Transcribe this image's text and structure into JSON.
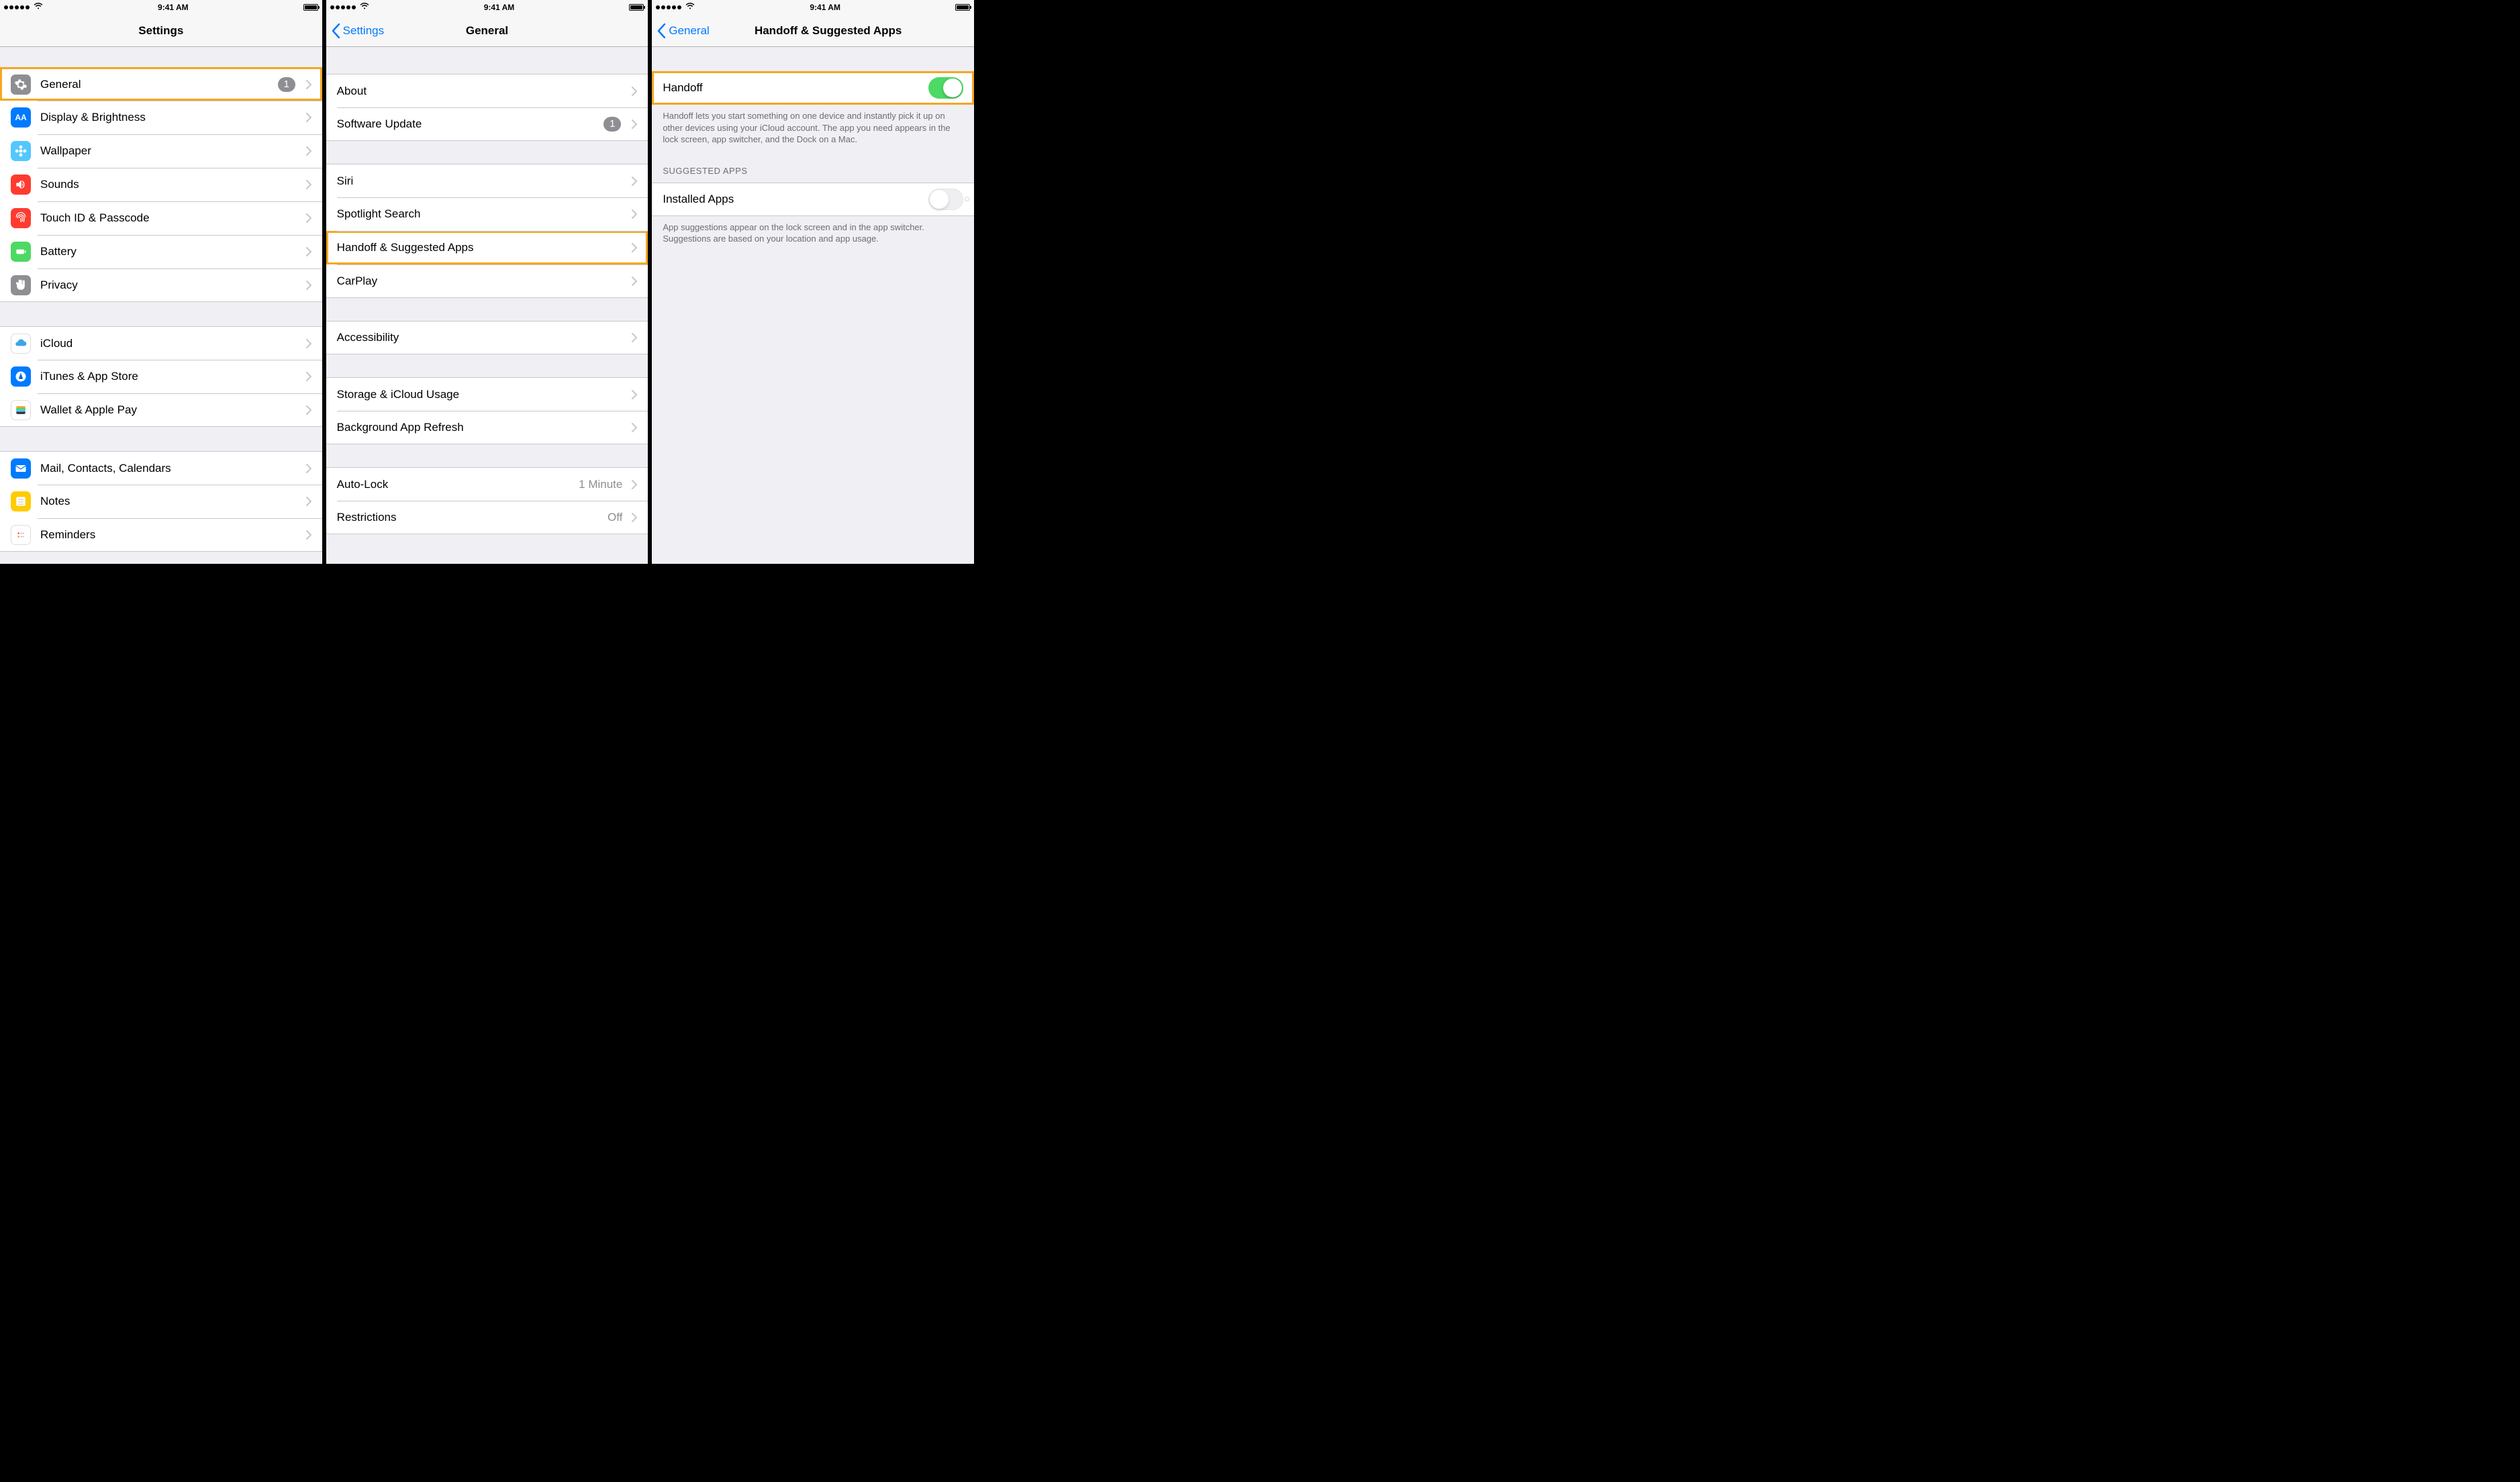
{
  "status": {
    "time": "9:41 AM"
  },
  "screen1": {
    "title": "Settings",
    "groups": [
      [
        {
          "id": "general",
          "label": "General",
          "icon": "gear",
          "color": "c-gray",
          "badge": "1",
          "chevron": true,
          "highlight": true
        },
        {
          "id": "display",
          "label": "Display & Brightness",
          "icon": "AA",
          "color": "c-blue",
          "chevron": true
        },
        {
          "id": "wallpaper",
          "label": "Wallpaper",
          "icon": "flower",
          "color": "c-cyan",
          "chevron": true
        },
        {
          "id": "sounds",
          "label": "Sounds",
          "icon": "speaker",
          "color": "c-red",
          "chevron": true
        },
        {
          "id": "touchid",
          "label": "Touch ID & Passcode",
          "icon": "fingerprint",
          "color": "c-red",
          "chevron": true
        },
        {
          "id": "battery",
          "label": "Battery",
          "icon": "battery",
          "color": "c-green",
          "chevron": true
        },
        {
          "id": "privacy",
          "label": "Privacy",
          "icon": "hand",
          "color": "c-darkgray",
          "chevron": true
        }
      ],
      [
        {
          "id": "icloud",
          "label": "iCloud",
          "icon": "cloud",
          "color": "c-white",
          "chevron": true
        },
        {
          "id": "itunes",
          "label": "iTunes & App Store",
          "icon": "appstore",
          "color": "c-blue",
          "chevron": true
        },
        {
          "id": "wallet",
          "label": "Wallet & Apple Pay",
          "icon": "wallet",
          "color": "c-white",
          "chevron": true
        }
      ],
      [
        {
          "id": "mail",
          "label": "Mail, Contacts, Calendars",
          "icon": "mail",
          "color": "c-blue",
          "chevron": true
        },
        {
          "id": "notes",
          "label": "Notes",
          "icon": "notes",
          "color": "c-yellow",
          "chevron": true
        },
        {
          "id": "reminders",
          "label": "Reminders",
          "icon": "reminders",
          "color": "c-white",
          "chevron": true
        }
      ]
    ]
  },
  "screen2": {
    "back": "Settings",
    "title": "General",
    "groups": [
      [
        {
          "id": "about",
          "label": "About",
          "chevron": true
        },
        {
          "id": "swupdate",
          "label": "Software Update",
          "badge": "1",
          "chevron": true
        }
      ],
      [
        {
          "id": "siri",
          "label": "Siri",
          "chevron": true
        },
        {
          "id": "spotlight",
          "label": "Spotlight Search",
          "chevron": true
        },
        {
          "id": "handoff",
          "label": "Handoff & Suggested Apps",
          "chevron": true,
          "highlight": true
        },
        {
          "id": "carplay",
          "label": "CarPlay",
          "chevron": true
        }
      ],
      [
        {
          "id": "accessibility",
          "label": "Accessibility",
          "chevron": true
        }
      ],
      [
        {
          "id": "storage",
          "label": "Storage & iCloud Usage",
          "chevron": true
        },
        {
          "id": "bgrefresh",
          "label": "Background App Refresh",
          "chevron": true
        }
      ],
      [
        {
          "id": "autolock",
          "label": "Auto-Lock",
          "detail": "1 Minute",
          "chevron": true
        },
        {
          "id": "restrictions",
          "label": "Restrictions",
          "detail": "Off",
          "chevron": true
        }
      ]
    ]
  },
  "screen3": {
    "back": "General",
    "title": "Handoff & Suggested Apps",
    "handoff": {
      "label": "Handoff",
      "on": true,
      "footer": "Handoff lets you start something on one device and instantly pick it up on other devices using your iCloud account. The app you need appears in the lock screen, app switcher, and the Dock on a Mac."
    },
    "suggested_header": "SUGGESTED APPS",
    "installed": {
      "label": "Installed Apps",
      "on": false,
      "footer": "App suggestions appear on the lock screen and in the app switcher. Suggestions are based on your location and app usage."
    }
  }
}
